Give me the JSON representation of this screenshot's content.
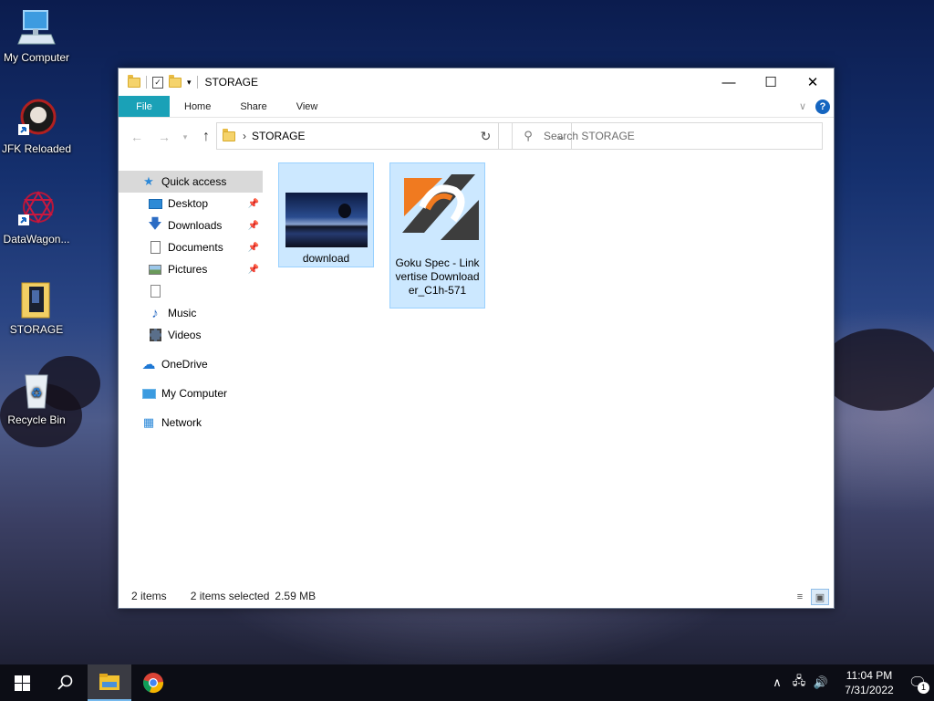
{
  "desktop": {
    "icons": [
      {
        "label": "My Computer",
        "icon": "monitor-icon"
      },
      {
        "label": "JFK Reloaded",
        "icon": "jfk-reloaded-shortcut-icon"
      },
      {
        "label": "DataWagon...",
        "icon": "datawagon-shortcut-icon"
      },
      {
        "label": "STORAGE",
        "icon": "folder-icon"
      },
      {
        "label": "Recycle Bin",
        "icon": "recycle-bin-icon"
      }
    ]
  },
  "window": {
    "title": "STORAGE",
    "ribbon_tabs": [
      "File",
      "Home",
      "Share",
      "View"
    ],
    "address": {
      "path": "STORAGE"
    },
    "search": {
      "placeholder": "Search STORAGE"
    },
    "nav": [
      {
        "label": "Quick access",
        "icon": "star-icon",
        "selected": true
      },
      {
        "label": "Desktop",
        "icon": "desktop-icon",
        "pinned": true
      },
      {
        "label": "Downloads",
        "icon": "download-arrow-icon",
        "pinned": true
      },
      {
        "label": "Documents",
        "icon": "document-icon",
        "pinned": true
      },
      {
        "label": "Pictures",
        "icon": "pictures-icon",
        "pinned": true
      },
      {
        "label": "",
        "icon": "blank-file-icon"
      },
      {
        "label": "Music",
        "icon": "music-note-icon"
      },
      {
        "label": "Videos",
        "icon": "film-icon"
      },
      {
        "label": "OneDrive",
        "icon": "cloud-icon"
      },
      {
        "label": "My Computer",
        "icon": "monitor-icon"
      },
      {
        "label": "Network",
        "icon": "network-icon"
      }
    ],
    "files": [
      {
        "name": "download",
        "icon": "photo-thumbnail"
      },
      {
        "name": "Goku Spec - Linkvertise Downloader_C1h-571",
        "icon": "app-logo-icon"
      }
    ],
    "status": {
      "count": "2 items",
      "selection": "2 items selected",
      "size": "2.59 MB"
    }
  },
  "taskbar": {
    "clock_time": "11:04 PM",
    "clock_date": "7/31/2022",
    "notification_count": "1"
  },
  "colors": {
    "file_tab": "#1aa1b7",
    "selection_bg": "#cce8ff",
    "selection_border": "#99d1ff",
    "taskbar": "#0c0d15"
  }
}
